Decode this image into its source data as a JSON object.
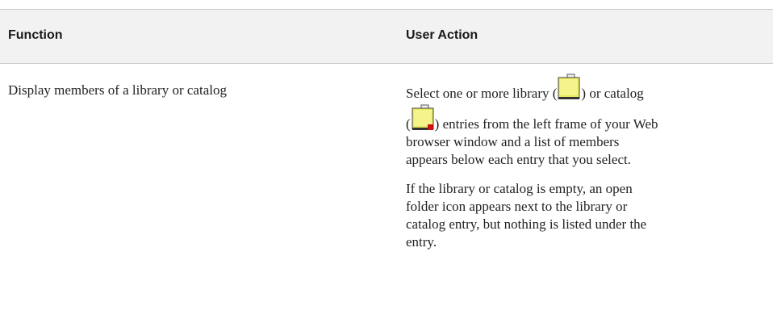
{
  "table": {
    "headers": {
      "function": "Function",
      "user_action": "User Action"
    },
    "rows": [
      {
        "function": "Display members of a library or catalog",
        "action": {
          "p1": {
            "l1_before": "Select one or more library (",
            "l1_mid": ") or catalog",
            "l2_open": "(",
            "l2_after": ") entries from the left frame of your Web",
            "l3": "browser window and a list of members",
            "l4": "appears below each entry that you select."
          },
          "p2": {
            "l1": "If the library or catalog is empty, an open",
            "l2": "folder icon appears next to the library or",
            "l3": "catalog entry, but nothing is listed under the",
            "l4": "entry."
          },
          "icons": [
            "library-folder-icon",
            "catalog-folder-icon"
          ]
        }
      }
    ]
  },
  "colors": {
    "header_bg": "#f2f2f2",
    "rule": "#c8c8c8",
    "folder_fill": "#e8e860",
    "catalog_badge": "#cc1111"
  }
}
